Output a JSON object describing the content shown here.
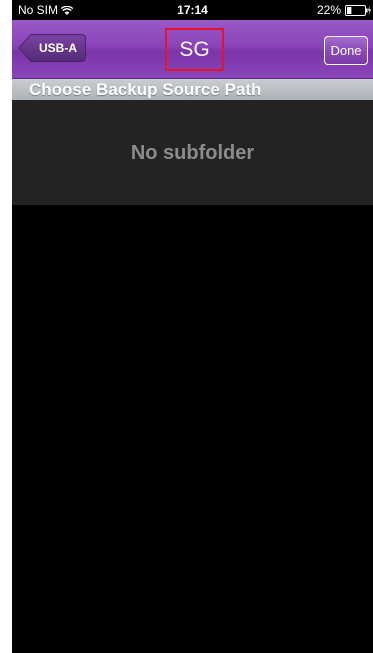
{
  "status_bar": {
    "carrier": "No SIM",
    "time": "17:14",
    "battery": "22%",
    "icons": [
      "wifi-icon",
      "battery-icon",
      "charging-bolt-icon"
    ]
  },
  "nav": {
    "back_label": "USB-A",
    "title": "SG",
    "done_label": "Done",
    "highlight_color": "#e8132a",
    "bar_color": "#8a43b9"
  },
  "section": {
    "header": "Choose Backup Source Path"
  },
  "content": {
    "empty_message": "No subfolder"
  }
}
